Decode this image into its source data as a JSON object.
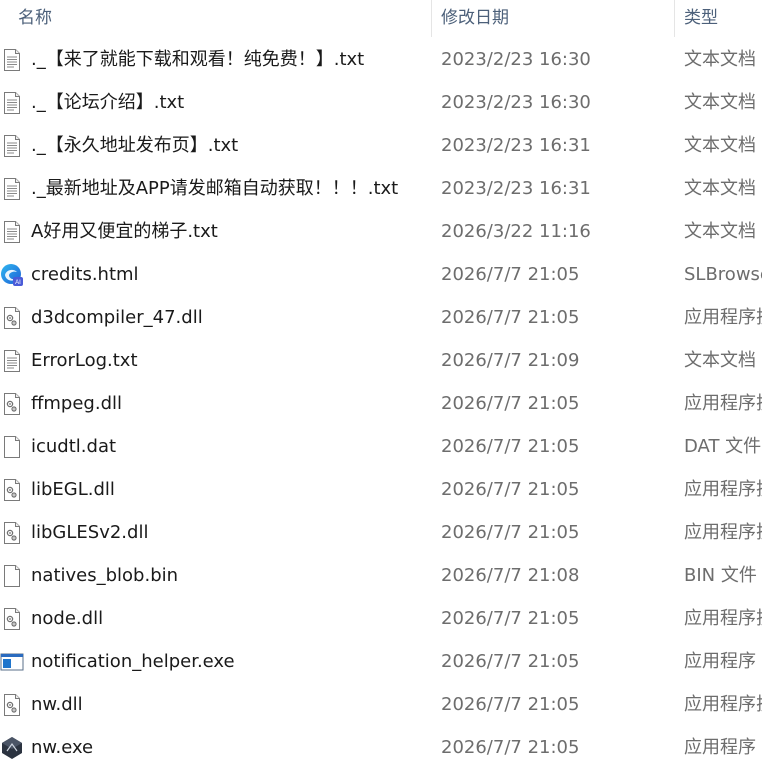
{
  "columns": {
    "name": "名称",
    "date": "修改日期",
    "type": "类型"
  },
  "files": [
    {
      "name": "._【来了就能下载和观看！纯免费！】.txt",
      "date": "2023/2/23 16:30",
      "type": "文本文档",
      "icon": "text-file-icon"
    },
    {
      "name": "._【论坛介绍】.txt",
      "date": "2023/2/23 16:30",
      "type": "文本文档",
      "icon": "text-file-icon"
    },
    {
      "name": "._【永久地址发布页】.txt",
      "date": "2023/2/23 16:31",
      "type": "文本文档",
      "icon": "text-file-icon"
    },
    {
      "name": "._最新地址及APP请发邮箱自动获取！！！.txt",
      "date": "2023/2/23 16:31",
      "type": "文本文档",
      "icon": "text-file-icon"
    },
    {
      "name": "A好用又便宜的梯子.txt",
      "date": "2026/3/22 11:16",
      "type": "文本文档",
      "icon": "text-file-icon"
    },
    {
      "name": "credits.html",
      "date": "2026/7/7 21:05",
      "type": "SLBrowse",
      "icon": "browser-html-icon"
    },
    {
      "name": "d3dcompiler_47.dll",
      "date": "2026/7/7 21:05",
      "type": "应用程序扩",
      "icon": "dll-file-icon"
    },
    {
      "name": "ErrorLog.txt",
      "date": "2026/7/7 21:09",
      "type": "文本文档",
      "icon": "text-file-icon"
    },
    {
      "name": "ffmpeg.dll",
      "date": "2026/7/7 21:05",
      "type": "应用程序扩",
      "icon": "dll-file-icon"
    },
    {
      "name": "icudtl.dat",
      "date": "2026/7/7 21:05",
      "type": "DAT 文件",
      "icon": "blank-file-icon"
    },
    {
      "name": "libEGL.dll",
      "date": "2026/7/7 21:05",
      "type": "应用程序扩",
      "icon": "dll-file-icon"
    },
    {
      "name": "libGLESv2.dll",
      "date": "2026/7/7 21:05",
      "type": "应用程序扩",
      "icon": "dll-file-icon"
    },
    {
      "name": "natives_blob.bin",
      "date": "2026/7/7 21:08",
      "type": "BIN 文件",
      "icon": "blank-file-icon"
    },
    {
      "name": "node.dll",
      "date": "2026/7/7 21:05",
      "type": "应用程序扩",
      "icon": "dll-file-icon"
    },
    {
      "name": "notification_helper.exe",
      "date": "2026/7/7 21:05",
      "type": "应用程序",
      "icon": "window-exe-icon"
    },
    {
      "name": "nw.dll",
      "date": "2026/7/7 21:05",
      "type": "应用程序扩",
      "icon": "dll-file-icon"
    },
    {
      "name": "nw.exe",
      "date": "2026/7/7 21:05",
      "type": "应用程序",
      "icon": "nw-exe-icon"
    }
  ]
}
